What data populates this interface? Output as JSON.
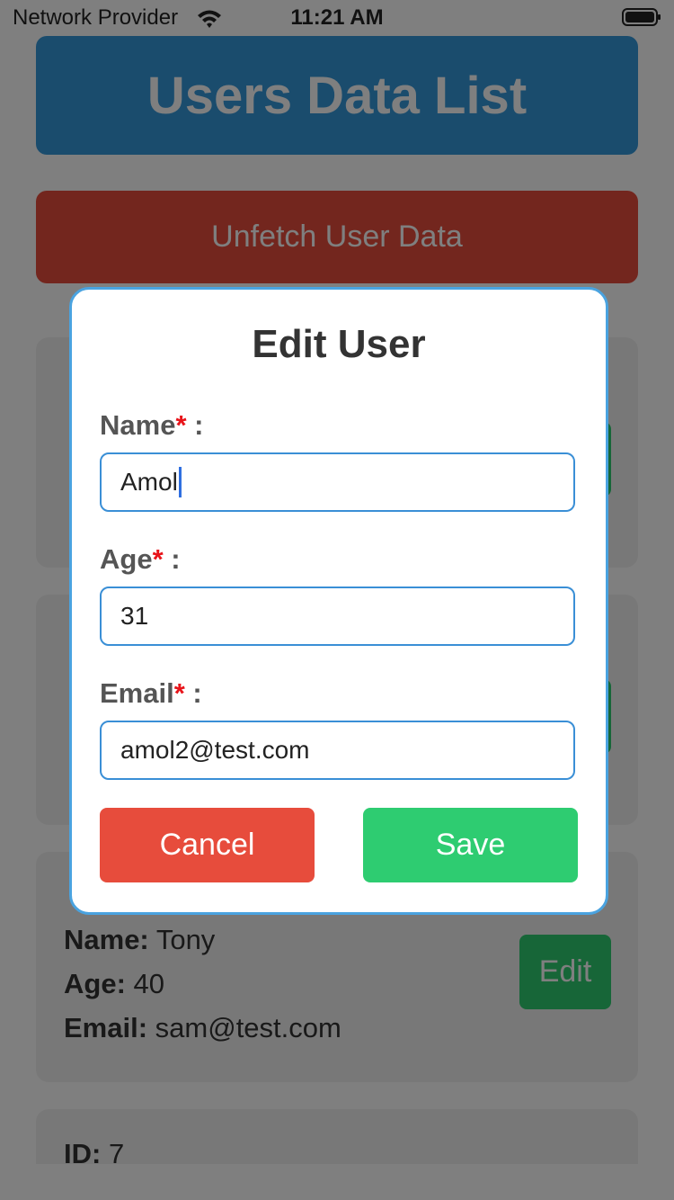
{
  "status_bar": {
    "provider": "Network Provider",
    "time": "11:21 AM"
  },
  "app": {
    "header_title": "Users Data List",
    "unfetch_label": "Unfetch User Data",
    "edit_label": "Edit",
    "field_labels": {
      "id": "ID:",
      "name": "Name:",
      "age": "Age:",
      "email": "Email:"
    },
    "cards": [
      {
        "name": "Tony",
        "age": "40",
        "email": "sam@test.com"
      },
      {
        "id": "7"
      }
    ]
  },
  "modal": {
    "title": "Edit User",
    "name_label": "Name",
    "age_label": "Age",
    "email_label": "Email",
    "required_mark": "*",
    "separator": ":",
    "name_value": "Amol",
    "age_value": "31",
    "email_value": "amol2@test.com",
    "cancel_label": "Cancel",
    "save_label": "Save"
  },
  "colors": {
    "header": "#3498db",
    "unfetch": "#e74c3c",
    "save": "#2ecc71",
    "cancel": "#e74c3c",
    "input_border": "#3a8fd6",
    "required": "#e8141a"
  }
}
